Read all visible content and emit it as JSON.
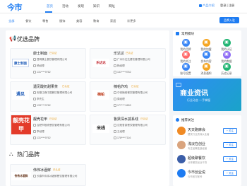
{
  "header": {
    "logo": "今市",
    "nav": [
      "首页",
      "活动",
      "发现",
      "知识",
      "网址"
    ],
    "top_right": [
      "产品介绍",
      "登录 | 注册"
    ]
  },
  "categories": {
    "items": [
      "全部",
      "餐饮",
      "零售",
      "服饰",
      "美容",
      "教育",
      "家居",
      "更多"
    ],
    "add_button": "品牌入驻"
  },
  "featured": {
    "title": "优选品牌",
    "cards": [
      {
        "name": "康土制面",
        "tag": "已认证",
        "logo": "康土制面",
        "company": "昆明康土餐饮管理有限公司",
        "contact": "杨经理",
        "phone": "131****9762"
      },
      {
        "name": "乐达达",
        "tag": "已认证",
        "logo": "乐达达",
        "company": "广州乐达达餐饮管理有限公司",
        "contact": "杨经理",
        "phone": "131****9762"
      },
      {
        "name": "遇见酸奶甜果茶",
        "tag": "已认证",
        "logo": "遇见",
        "company": "安徽江峰中国餐饮管理有限公司",
        "contact": "李先生",
        "phone": "133****0762"
      },
      {
        "name": "楠帕炸鸡",
        "tag": "已认证",
        "logo": "楠帕",
        "company": "中徐楠帕餐饮管理有限公司",
        "contact": "周经理",
        "phone": "177****4653"
      },
      {
        "name": "靓壳花甲",
        "tag": "已认证",
        "logo": "靓壳花甲",
        "company": "合肥市靓壳餐饮管理有限公司",
        "contact": "李经理",
        "phone": "131****9762"
      },
      {
        "name": "鲁梁深水孤系线",
        "tag": "已认证",
        "logo": "米线",
        "company": "沈阳鲁梁餐饮管理有限公司",
        "contact": "王经理",
        "phone": "178****7116"
      }
    ]
  },
  "hot": {
    "title": "热门品牌",
    "cards": [
      {
        "name": "伟伟冰酒鲜",
        "tag": "已认证",
        "logo": "伟伟冰酒鲜",
        "company": "长春市伟伟冰酒鲜餐饮管理有限公司"
      }
    ]
  },
  "tools": {
    "title": "常用模块",
    "items": [
      {
        "label": "我的品牌",
        "color": "#3a86f5"
      },
      {
        "label": "我的加盟",
        "color": "#f5a623"
      },
      {
        "label": "我的认证",
        "color": "#22b573"
      },
      {
        "label": "我的关注",
        "color": "#ff6b6b"
      },
      {
        "label": "发布内容",
        "color": "#3a86f5"
      },
      {
        "label": "我的数据",
        "color": "#8e6cf5"
      },
      {
        "label": "账号设置",
        "color": "#3a86f5"
      },
      {
        "label": "消息通知",
        "color": "#f5a623"
      },
      {
        "label": "历史记录",
        "color": "#22b573"
      }
    ]
  },
  "banner": {
    "text": "商业资讯",
    "sub": "行业动态 一手掌握"
  },
  "recommend": {
    "title": "推荐关注",
    "follow_label": "关注",
    "people": [
      {
        "name": "天天跑麻会",
        "desc": "餐饮行业资深从业者",
        "color": "#f08a24"
      },
      {
        "name": "浅淡在创业",
        "desc": "专注品牌连锁经营",
        "color": "#d9a47e"
      },
      {
        "name": "超级聊餐饮",
        "desc": "分享餐饮创业干货",
        "color": "#3b5ea8"
      },
      {
        "name": "今市创业说",
        "desc": "今市官方账号",
        "color": "#1e7cf2"
      }
    ]
  }
}
